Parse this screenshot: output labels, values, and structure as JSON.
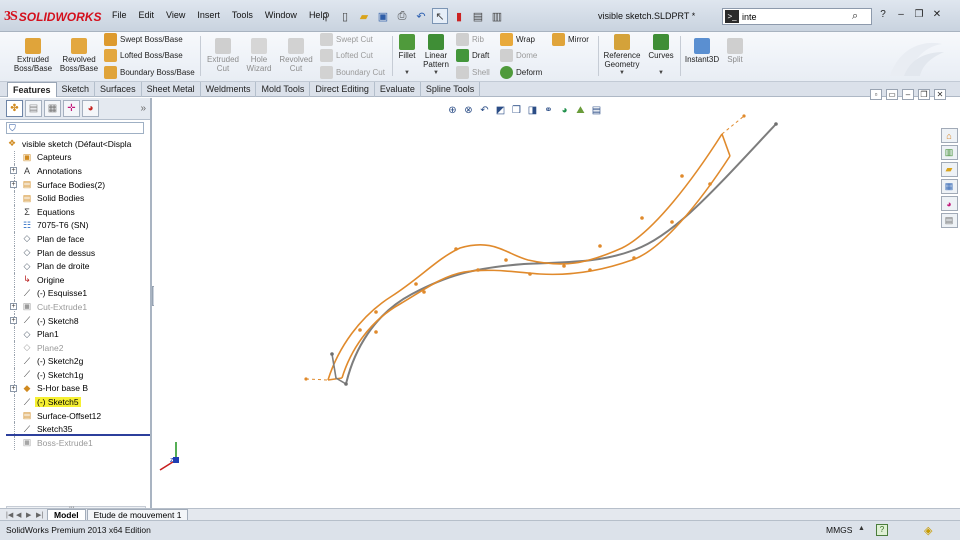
{
  "app": {
    "logo_ds": "3S",
    "logo_name": "SOLIDWORKS",
    "document_title": "visible sketch.SLDPRT *"
  },
  "menu": [
    "File",
    "Edit",
    "View",
    "Insert",
    "Tools",
    "Window",
    "Help"
  ],
  "search": {
    "value": "inte",
    "term_label": ">_"
  },
  "ribbon": {
    "extruded_boss": "Extruded Boss/Base",
    "revolved_boss": "Revolved Boss/Base",
    "swept_boss": "Swept Boss/Base",
    "lofted_boss": "Lofted Boss/Base",
    "boundary_boss": "Boundary Boss/Base",
    "extruded_cut": "Extruded Cut",
    "hole_wizard": "Hole Wizard",
    "revolved_cut": "Revolved Cut",
    "swept_cut": "Swept Cut",
    "lofted_cut": "Lofted Cut",
    "boundary_cut": "Boundary Cut",
    "fillet": "Fillet",
    "linear_pattern": "Linear Pattern",
    "rib": "Rib",
    "draft": "Draft",
    "shell": "Shell",
    "wrap": "Wrap",
    "dome": "Dome",
    "deform": "Deform",
    "mirror": "Mirror",
    "reference_geometry": "Reference Geometry",
    "curves": "Curves",
    "instant3d": "Instant3D",
    "split": "Split"
  },
  "tabs": [
    "Features",
    "Sketch",
    "Surfaces",
    "Sheet Metal",
    "Weldments",
    "Mold Tools",
    "Direct Editing",
    "Evaluate",
    "Spline Tools"
  ],
  "tree": {
    "root": "visible sketch  (Défaut<Displa",
    "items": [
      {
        "label": "Capteurs",
        "plus": false,
        "grey": false,
        "hl": false,
        "icon": "sensor-icon",
        "glyph": "▣",
        "color": "#d08a1f"
      },
      {
        "label": "Annotations",
        "plus": true,
        "grey": false,
        "hl": false,
        "icon": "annotation-icon",
        "glyph": "A",
        "color": "#3a3a3a"
      },
      {
        "label": "Surface Bodies(2)",
        "plus": true,
        "grey": false,
        "hl": false,
        "icon": "surface-bodies-icon",
        "glyph": "▤",
        "color": "#d08a1f"
      },
      {
        "label": "Solid Bodies",
        "plus": false,
        "grey": false,
        "hl": false,
        "icon": "solid-bodies-icon",
        "glyph": "▤",
        "color": "#d08a1f"
      },
      {
        "label": "Equations",
        "plus": false,
        "grey": false,
        "hl": false,
        "icon": "equations-icon",
        "glyph": "Σ",
        "color": "#3a3a3a"
      },
      {
        "label": "7075-T6 (SN)",
        "plus": false,
        "grey": false,
        "hl": false,
        "icon": "material-icon",
        "glyph": "☷",
        "color": "#2e6fc5"
      },
      {
        "label": "Plan de face",
        "plus": false,
        "grey": false,
        "hl": false,
        "icon": "plane-icon",
        "glyph": "◇",
        "color": "#5f6a78"
      },
      {
        "label": "Plan de dessus",
        "plus": false,
        "grey": false,
        "hl": false,
        "icon": "plane-icon",
        "glyph": "◇",
        "color": "#5f6a78"
      },
      {
        "label": "Plan de droite",
        "plus": false,
        "grey": false,
        "hl": false,
        "icon": "plane-icon",
        "glyph": "◇",
        "color": "#5f6a78"
      },
      {
        "label": "Origine",
        "plus": false,
        "grey": false,
        "hl": false,
        "icon": "origin-icon",
        "glyph": "↳",
        "color": "#b81d1d"
      },
      {
        "label": "(-) Esquisse1",
        "plus": false,
        "grey": false,
        "hl": false,
        "icon": "sketch-icon",
        "glyph": "⟋",
        "color": "#3a3a3a"
      },
      {
        "label": "Cut-Extrude1",
        "plus": true,
        "grey": true,
        "hl": false,
        "icon": "cut-extrude-icon",
        "glyph": "▣",
        "color": "#9a9a9a"
      },
      {
        "label": "(-) Sketch8",
        "plus": true,
        "grey": false,
        "hl": false,
        "icon": "sketch-icon",
        "glyph": "⟋",
        "color": "#3a3a3a"
      },
      {
        "label": "Plan1",
        "plus": false,
        "grey": false,
        "hl": false,
        "icon": "plane-icon",
        "glyph": "◇",
        "color": "#5f6a78"
      },
      {
        "label": "Plane2",
        "plus": false,
        "grey": true,
        "hl": false,
        "icon": "plane-icon",
        "glyph": "◇",
        "color": "#a6a6a6"
      },
      {
        "label": "(-) Sketch2g",
        "plus": false,
        "grey": false,
        "hl": false,
        "icon": "sketch-icon",
        "glyph": "⟋",
        "color": "#3a3a3a"
      },
      {
        "label": "(-) Sketch1g",
        "plus": false,
        "grey": false,
        "hl": false,
        "icon": "sketch-icon",
        "glyph": "⟋",
        "color": "#3a3a3a"
      },
      {
        "label": "S-Hor base B",
        "plus": true,
        "grey": false,
        "hl": false,
        "icon": "surface-feature-icon",
        "glyph": "◆",
        "color": "#d08a1f"
      },
      {
        "label": "(-) Sketch5",
        "plus": false,
        "grey": false,
        "hl": true,
        "icon": "sketch-icon",
        "glyph": "⟋",
        "color": "#3a3a3a"
      },
      {
        "label": "Surface-Offset12",
        "plus": false,
        "grey": false,
        "hl": false,
        "icon": "surface-offset-icon",
        "glyph": "▤",
        "color": "#d08a1f"
      },
      {
        "label": "Sketch35",
        "plus": false,
        "grey": false,
        "hl": false,
        "icon": "sketch-icon",
        "glyph": "⟋",
        "color": "#3a3a3a"
      },
      {
        "label": "Boss-Extrude1",
        "plus": false,
        "grey": true,
        "hl": false,
        "icon": "boss-extrude-icon",
        "glyph": "▣",
        "color": "#a6a6a6"
      }
    ]
  },
  "bottom_tabs": [
    "Model",
    "Etude de mouvement 1"
  ],
  "status": {
    "edition": "SolidWorks Premium 2013 x64 Edition",
    "units": "MMGS"
  },
  "colors": {
    "sketch_orange": "#e08a2c",
    "edge_grey": "#7d7d7d",
    "highlight": "#f6f032"
  }
}
